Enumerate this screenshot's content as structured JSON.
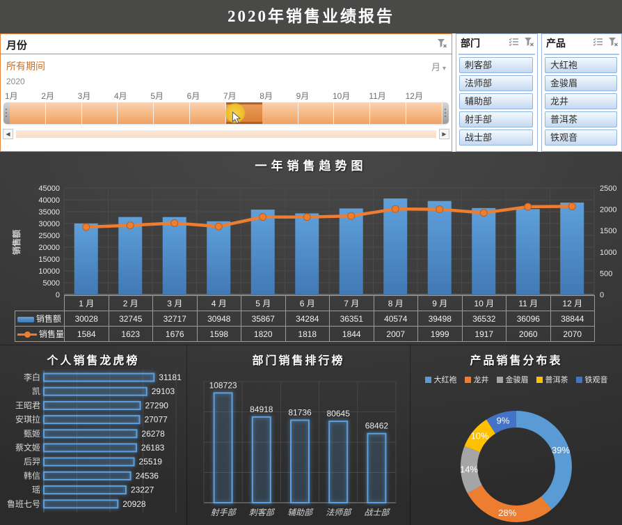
{
  "app": {
    "title": "2020年销售业绩报告"
  },
  "icons": {
    "timeline_clear_filter": "funnel-x-icon",
    "slicer_multi_select": "list-check-icon",
    "slicer_clear_filter": "funnel-x-icon",
    "dropdown_arrow": "▾",
    "scroll_left": "◀",
    "scroll_right": "▶"
  },
  "timeline": {
    "title": "月份",
    "selection_label": "所有期间",
    "granularity": "月",
    "year": "2020",
    "months": [
      "1月",
      "2月",
      "3月",
      "4月",
      "5月",
      "6月",
      "7月",
      "8月",
      "9月",
      "10月",
      "11月",
      "12月"
    ],
    "selected_index": 6
  },
  "slicers": [
    {
      "title": "部门",
      "items": [
        "刺客部",
        "法师部",
        "辅助部",
        "射手部",
        "战士部"
      ]
    },
    {
      "title": "产品",
      "items": [
        "大红袍",
        "金骏眉",
        "龙井",
        "普洱茶",
        "铁观音"
      ]
    }
  ],
  "colors": {
    "accent_orange": "#ED7D31",
    "bar_blue": "#4E8CCB",
    "outline_blue": "#5BA0E0",
    "dark_bg": "#3a3a3a",
    "donut": [
      "#5B9BD5",
      "#ED7D31",
      "#A5A5A5",
      "#FFC000",
      "#4472C4"
    ]
  },
  "chart_data": [
    {
      "type": "bar-line-combo",
      "title": "一年销售趋势图",
      "categories": [
        "1月",
        "2月",
        "3月",
        "4月",
        "5月",
        "6月",
        "7月",
        "8月",
        "9月",
        "10月",
        "11月",
        "12月"
      ],
      "table_categories": [
        "1 月",
        "2 月",
        "3 月",
        "4 月",
        "5 月",
        "6 月",
        "7 月",
        "8 月",
        "9 月",
        "10 月",
        "11 月",
        "12 月"
      ],
      "series": [
        {
          "name": "销售额",
          "type": "bar",
          "axis": "left",
          "values": [
            30028,
            32745,
            32717,
            30948,
            35867,
            34284,
            36351,
            40574,
            39498,
            36532,
            36096,
            38844
          ]
        },
        {
          "name": "销售量",
          "type": "line",
          "axis": "right",
          "values": [
            1584,
            1623,
            1676,
            1598,
            1820,
            1818,
            1844,
            2007,
            1999,
            1917,
            2060,
            2070
          ]
        }
      ],
      "axes": {
        "left": {
          "title": "销售额",
          "min": 0,
          "max": 45000,
          "step": 5000
        },
        "right": {
          "min": 0,
          "max": 2500,
          "step": 500
        }
      },
      "grid": true,
      "legend_position": "table-left"
    },
    {
      "type": "bar-horizontal",
      "title": "个人销售龙虎榜",
      "categories": [
        "李白",
        "凯",
        "王昭君",
        "安琪拉",
        "甄姬",
        "蔡文姬",
        "后羿",
        "韩信",
        "瑶",
        "鲁班七号"
      ],
      "values": [
        31181,
        29103,
        27290,
        27077,
        26278,
        26183,
        25519,
        24536,
        23227,
        20928
      ],
      "xlim": [
        0,
        32500
      ]
    },
    {
      "type": "bar",
      "title": "部门销售排行榜",
      "categories": [
        "射手部",
        "刺客部",
        "辅助部",
        "法师部",
        "战士部"
      ],
      "values": [
        108723,
        84918,
        81736,
        80645,
        68462
      ],
      "ylim": [
        0,
        120000
      ]
    },
    {
      "type": "donut",
      "title": "产品销售分布表",
      "legend": [
        "大红袍",
        "龙井",
        "金骏眉",
        "普洱茶",
        "铁观音"
      ],
      "values_pct": [
        39,
        28,
        14,
        10,
        9
      ],
      "labels": [
        "39%",
        "28%",
        "14%",
        "10%",
        "9%"
      ],
      "colors": [
        "#5B9BD5",
        "#ED7D31",
        "#A5A5A5",
        "#FFC000",
        "#4472C4"
      ],
      "legend_position": "top"
    }
  ]
}
